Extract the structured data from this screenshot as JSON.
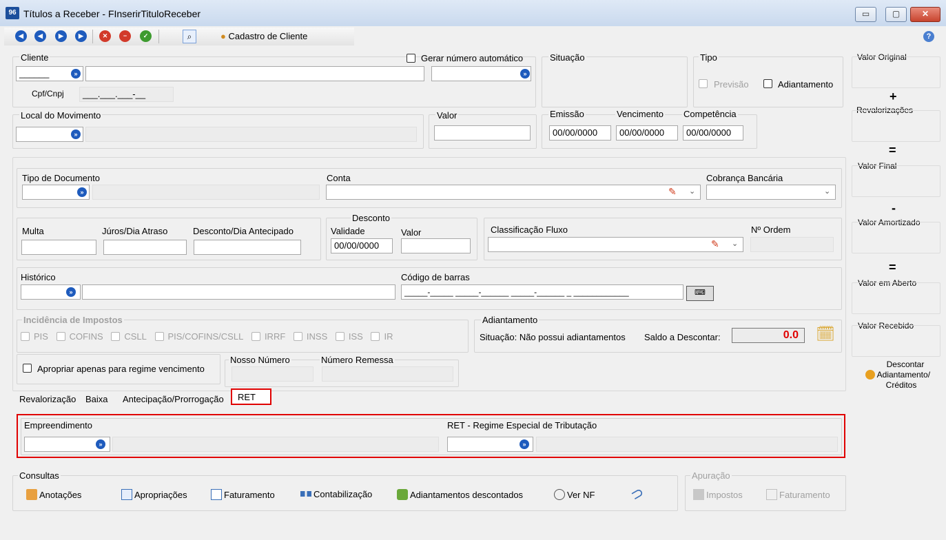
{
  "window": {
    "title": "Títulos a Receber - FInserirTituloReceber",
    "app_icon": "96",
    "controls": {
      "minimize": "▭",
      "maximize": "▢",
      "close": "✕"
    }
  },
  "toolbar": {
    "first_icon": "first-record-icon",
    "prev_icon": "prev-record-icon",
    "next_icon": "next-record-icon",
    "last_icon": "last-record-icon",
    "cancel_icon": "cancel-icon",
    "delete_icon": "delete-icon",
    "confirm_icon": "confirm-icon",
    "search_icon": "search-icon",
    "cadastro_cliente": "Cadastro de Cliente",
    "help_icon": "help-icon"
  },
  "cliente": {
    "label": "Cliente",
    "code_value": "______",
    "gerar_numero": "Gerar número automático",
    "cpf_label": "Cpf/Cnpj",
    "cpf_value": "___.___.___-__"
  },
  "situacao": {
    "label": "Situação"
  },
  "tipo": {
    "label": "Tipo",
    "previsao": "Previsão",
    "adiantamento": "Adiantamento"
  },
  "local": {
    "label": "Local do Movimento"
  },
  "valor": {
    "label": "Valor"
  },
  "datas": {
    "emissao_label": "Emissão",
    "emissao_value": "00/00/0000",
    "vencimento_label": "Vencimento",
    "vencimento_value": "00/00/0000",
    "competencia_label": "Competência",
    "competencia_value": "00/00/0000"
  },
  "documento": {
    "tipo_label": "Tipo de Documento",
    "conta_label": "Conta",
    "cobranca_label": "Cobrança Bancária"
  },
  "encargos": {
    "multa": "Multa",
    "juros": "Júros/Dia Atraso",
    "desconto_antecipado": "Desconto/Dia Antecipado",
    "desconto_group": "Desconto",
    "validade": "Validade",
    "validade_value": "00/00/0000",
    "valor": "Valor",
    "classificacao": "Classificação Fluxo",
    "n_ordem": "Nº Ordem"
  },
  "historico": {
    "label": "Histórico",
    "codigo_barras_label": "Código de barras",
    "codigo_barras_value": "_____-_____ _____-______ _____-______ _ ____________"
  },
  "impostos": {
    "label": "Incidência de Impostos",
    "items": [
      "PIS",
      "COFINS",
      "CSLL",
      "PIS/COFINS/CSLL",
      "IRRF",
      "INSS",
      "ISS",
      "IR"
    ]
  },
  "adiantamento_box": {
    "label": "Adiantamento",
    "situacao": "Situação: Não possui adiantamentos",
    "saldo_label": "Saldo a Descontar:",
    "saldo_value": "0.0"
  },
  "apropriar": {
    "label": "Apropriar apenas para regime vencimento"
  },
  "nosso_numero": {
    "label": "Nosso Número"
  },
  "numero_remessa": {
    "label": "Número Remessa"
  },
  "tabs": [
    {
      "label": "Revalorização"
    },
    {
      "label": "Baixa"
    },
    {
      "label": "Antecipação/Prorrogação"
    },
    {
      "label": "RET"
    }
  ],
  "ret": {
    "empreendimento": "Empreendimento",
    "regime": "RET - Regime Especial de Tributação"
  },
  "consultas": {
    "label": "Consultas",
    "items": [
      "Anotações",
      "Apropriações",
      "Faturamento",
      "Contabilização",
      "Adiantamentos descontados",
      "Ver NF"
    ]
  },
  "apuracao": {
    "label": "Apuração",
    "items": [
      "Impostos",
      "Faturamento"
    ]
  },
  "sidebar": {
    "valor_original": "Valor Original",
    "plus": "+",
    "revalorizacoes": "Revalorizações",
    "eq1": "=",
    "valor_final": "Valor Final",
    "minus": "-",
    "valor_amortizado": "Valor Amortizado",
    "eq2": "=",
    "valor_aberto": "Valor em Aberto",
    "valor_recebido": "Valor Recebido",
    "descontar_l1": "Descontar",
    "descontar_l2": "Adiantamento/",
    "descontar_l3": "Créditos"
  },
  "colors": {
    "accent": "#1e5bbd",
    "highlight": "#e00000",
    "saldo": "#e00000"
  }
}
